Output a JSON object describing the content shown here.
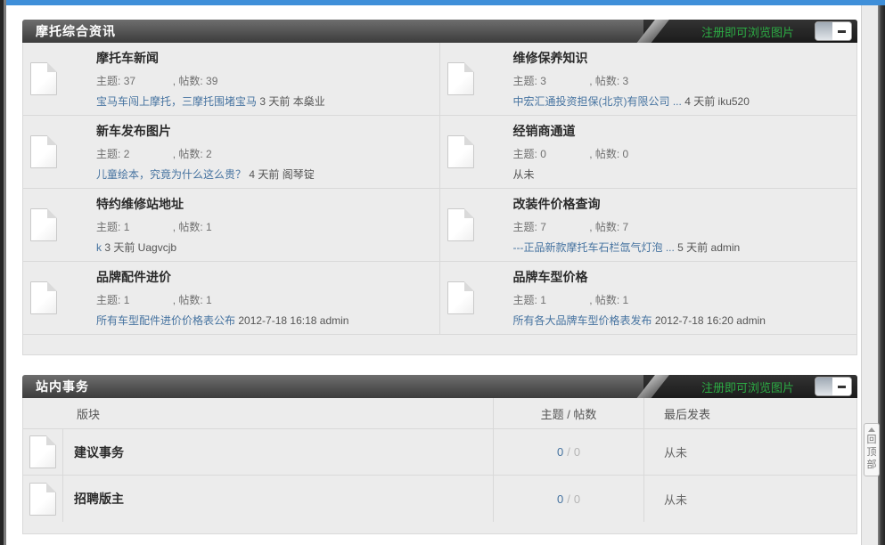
{
  "colors": {
    "top_bar_blue": "#3f8fd9",
    "header_bar_dark": "#3c3c3c",
    "green_link": "#2cab44",
    "link_blue": "#4673a0",
    "panel_bg": "#ececec"
  },
  "header_right": {
    "register_link": "注册即可浏览图片"
  },
  "section1": {
    "title": "摩托综合资讯",
    "topics_label": "主题:",
    "posts_label": ", 帖数:",
    "forums": [
      {
        "name": "摩托车新闻",
        "topics": "37",
        "posts": "39",
        "last_title": "宝马车闯上摩托，三摩托围堵宝马",
        "last_meta": "3 天前 本燊业"
      },
      {
        "name": "维修保养知识",
        "topics": "3",
        "posts": "3",
        "last_title": "中宏汇通投资担保(北京)有限公司 ...",
        "last_meta": "4 天前 iku520"
      },
      {
        "name": "新车发布图片",
        "topics": "2",
        "posts": "2",
        "last_title": "儿童绘本，究竟为什么这么贵？",
        "last_meta": "4 天前 阁琴锭"
      },
      {
        "name": "经销商通道",
        "topics": "0",
        "posts": "0",
        "last_title": "",
        "last_meta": "从未"
      },
      {
        "name": "特约维修站地址",
        "topics": "1",
        "posts": "1",
        "last_title": "k",
        "last_meta": "3 天前 Uagvcjb"
      },
      {
        "name": "改装件价格查询",
        "topics": "7",
        "posts": "7",
        "last_title": "---正品新款摩托车石栏氙气灯泡 ...",
        "last_meta": "5 天前 admin"
      },
      {
        "name": "品牌配件进价",
        "topics": "1",
        "posts": "1",
        "last_title": "所有车型配件进价价格表公布",
        "last_meta": "2012-7-18 16:18 admin"
      },
      {
        "name": "品牌车型价格",
        "topics": "1",
        "posts": "1",
        "last_title": "所有各大品牌车型价格表发布",
        "last_meta": "2012-7-18 16:20 admin"
      }
    ]
  },
  "section2": {
    "title": "站内事务",
    "columns": {
      "forum": "版块",
      "stats": "主题 / 帖数",
      "lastpost": "最后发表"
    },
    "stats_separator": "/",
    "rows": [
      {
        "name": "建议事务",
        "topics": "0",
        "posts": "0",
        "last": "从未"
      },
      {
        "name": "招聘版主",
        "topics": "0",
        "posts": "0",
        "last": "从未"
      }
    ]
  },
  "back_to_top": {
    "chars": [
      "回",
      "顶",
      "部"
    ]
  }
}
